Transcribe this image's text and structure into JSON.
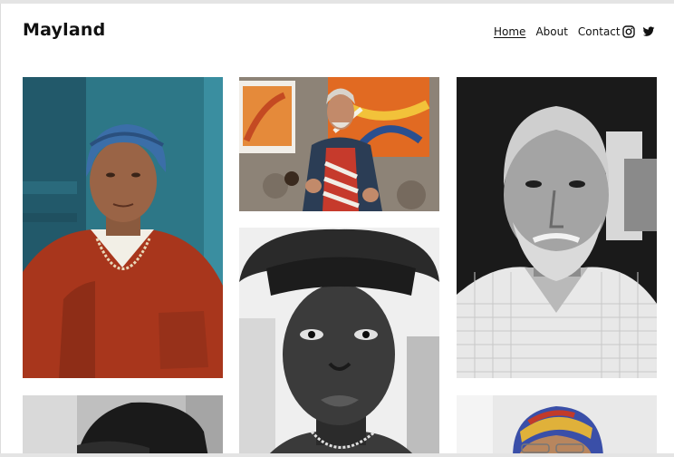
{
  "site": {
    "brand": "Mayland"
  },
  "nav": {
    "items": [
      {
        "label": "Home",
        "active": true
      },
      {
        "label": "About",
        "active": false
      },
      {
        "label": "Contact",
        "active": false
      }
    ]
  },
  "social": {
    "icons": [
      "instagram-icon",
      "twitter-icon"
    ]
  },
  "gallery": {
    "photos": [
      "woman-blue-headscarf-portrait",
      "painter-at-work-photo",
      "elderly-man-bw-portrait",
      "young-man-cap-bw-portrait",
      "person-cap-bw-photo",
      "woman-colorful-headwrap-photo"
    ]
  },
  "colors": {
    "background": "#ffffff",
    "text": "#111111",
    "teal_wall": "#2f7d8c",
    "red_sweater": "#b33a1f",
    "blue_scarf": "#3a69a8"
  }
}
